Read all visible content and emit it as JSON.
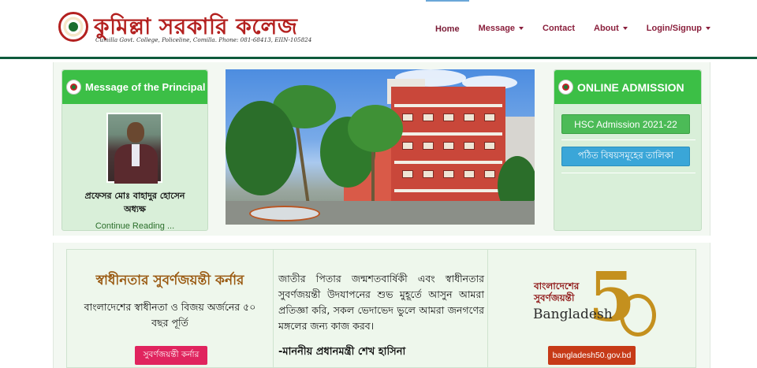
{
  "brand": {
    "title": "কুমিল্লা সরকারি কলেজ",
    "subtitle": "Cumilla Govt. College, Policeline, Comilla. Phone: 081-68413, EIIN-105824"
  },
  "nav": {
    "items": [
      {
        "label": "Home"
      },
      {
        "label": "Message"
      },
      {
        "label": "Contact"
      },
      {
        "label": "About"
      },
      {
        "label": "Login/Signup"
      }
    ]
  },
  "principal_card": {
    "title": "Message of the Principal",
    "name": "প্রফেসর মোঃ বাহাদুর হোসেন",
    "role": "অধ্যক্ষ",
    "link": "Continue Reading ..."
  },
  "admission_card": {
    "title": "ONLINE ADMISSION",
    "buttons": [
      {
        "label": "HSC Admission 2021-22"
      },
      {
        "label": "পঠিত বিষয়সমূহের তালিকা"
      }
    ]
  },
  "jubilee": {
    "title": "স্বাধীনতার সুবর্ণজয়ন্তী কর্নার",
    "text": "বাংলাদেশের স্বাধীনতা ও বিজয় অর্জনের ৫০ বছর পূর্তি",
    "button": "সুবর্ণজয়ন্তী কর্নার"
  },
  "pledge": {
    "text": "জাতীর পিতার জন্মশতবার্ষিকী এবং স্বাধীনতার সুবর্ণজয়ন্তী উদযাপনের শুভ মুহূর্তে আসুন আমরা প্রতিজ্ঞা করি, সকল ভেদাভেদ ভুলে আমরা জনগণের মঙ্গলের জন্য কাজ করব।",
    "signature": "-মাননীয় প্রধানমন্ত্রী শেখ হাসিনা"
  },
  "bd50": {
    "logo_bn_line1": "বাংলাদেশের",
    "logo_bn_line2": "সুবর্ণজয়ন্তী",
    "logo_en": "Bangladesh",
    "logo_num_5": "5",
    "button": "bangladesh50.gov.bd"
  },
  "colors": {
    "brand_red": "#b3201f",
    "nav_text": "#8a1f3c",
    "card_header_green": "#3cbf46",
    "header_rule": "#0e5a3c",
    "jubilee_button": "#e0245e",
    "bd50_button": "#c63a17"
  }
}
